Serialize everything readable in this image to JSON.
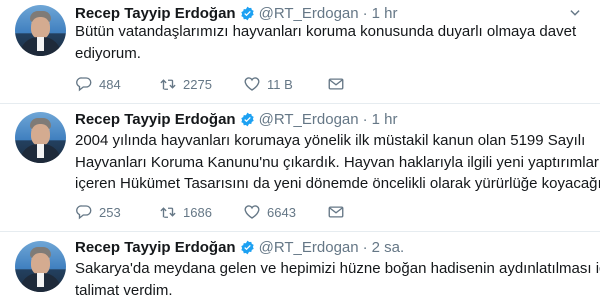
{
  "tweets": [
    {
      "name": "Recep Tayyip Erdoğan",
      "handle": "@RT_Erdogan",
      "separator": "·",
      "time": "1 hr",
      "lines": [
        "Bütün vatandaşlarımızı hayvanları koruma konusunda duyarlı olmaya davet",
        "ediyorum."
      ],
      "replies": "484",
      "retweets": "2275",
      "likes": "11 B"
    },
    {
      "name": "Recep Tayyip Erdoğan",
      "handle": "@RT_Erdogan",
      "separator": "·",
      "time": "1 hr",
      "lines": [
        "2004 yılında hayvanları korumaya yönelik ilk müstakil kanun olan 5199 Sayılı",
        "Hayvanları Koruma Kanunu'nu çıkardık. Hayvan haklarıyla ilgili yeni yaptırımları",
        "içeren Hükümet Tasarısını da yeni dönemde öncelikli olarak yürürlüğe koyacağız."
      ],
      "replies": "253",
      "retweets": "1686",
      "likes": "6643"
    },
    {
      "name": "Recep Tayyip Erdoğan",
      "handle": "@RT_Erdogan",
      "separator": "·",
      "time": "2 sa.",
      "lines": [
        "Sakarya'da meydana gelen ve hepimizi hüzne boğan hadisenin aydınlatılması için",
        "talimat verdim."
      ]
    }
  ],
  "icons": {
    "verified": "verified-badge-icon",
    "caret": "chevron-down-icon",
    "reply": "reply-icon",
    "retweet": "retweet-icon",
    "like": "heart-icon",
    "dm": "envelope-icon"
  },
  "colors": {
    "verified": "#1da1f2",
    "meta": "#657786",
    "text": "#14171a",
    "divider": "#e6ecf0"
  }
}
